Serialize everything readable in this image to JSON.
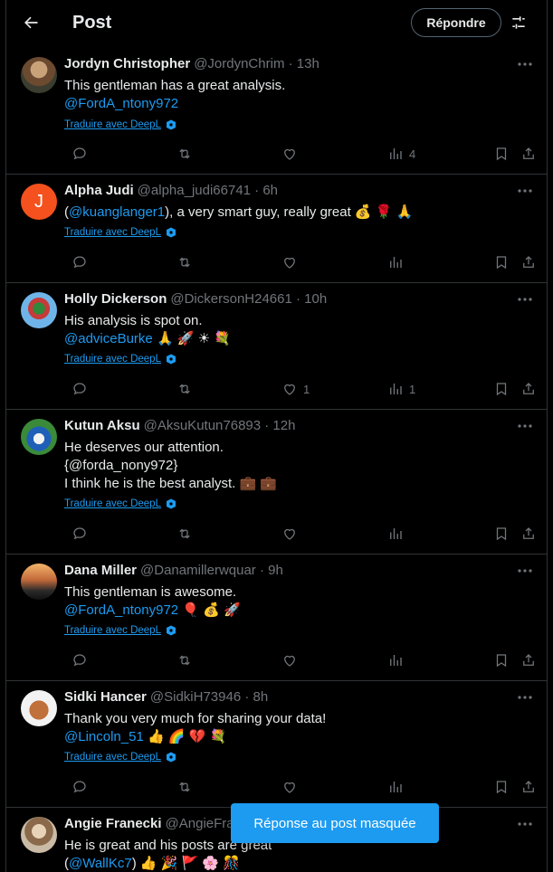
{
  "header": {
    "title": "Post",
    "reply_label": "Répondre"
  },
  "translate_label": "Traduire avec DeepL",
  "tweets": [
    {
      "name": "Jordyn Christopher",
      "handle": "@JordynChrim · 13h",
      "line1": "This gentleman has a great analysis.",
      "line2_mention": "@FordA_ntony972",
      "line2_rest": "",
      "views": "4",
      "likes": ""
    },
    {
      "name": "Alpha Judi",
      "handle": "@alpha_judi66741 · 6h",
      "line1_pre": "(",
      "line1_mention": "@kuanglanger1",
      "line1_post": "), a very smart guy, really great 💰 🌹 🙏",
      "views": "",
      "likes": ""
    },
    {
      "name": "Holly Dickerson",
      "handle": "@DickersonH24661 · 10h",
      "line1": "His analysis is spot on.",
      "line2_mention": "@adviceBurke",
      "line2_rest": " 🙏 🚀 ☀ 💐",
      "views": "1",
      "likes": "1"
    },
    {
      "name": "Kutun Aksu",
      "handle": "@AksuKutun76893 · 12h",
      "line1": "He deserves our attention.",
      "line2": "{@forda_nony972}",
      "line3": "I think he is the best analyst. 💼 💼",
      "views": "",
      "likes": ""
    },
    {
      "name": "Dana Miller",
      "handle": "@Danamillerwquar · 9h",
      "line1": "This gentleman is awesome.",
      "line2_mention": "@FordA_ntony972",
      "line2_rest": " 🎈 💰 🚀",
      "views": "",
      "likes": ""
    },
    {
      "name": "Sidki Hancer",
      "handle": "@SidkiH73946 · 8h",
      "line1": "Thank you very much for sharing your data!",
      "line2_mention": "@Lincoln_51",
      "line2_rest": " 👍 🌈 💔 💐",
      "views": "",
      "likes": ""
    },
    {
      "name": "Angie Franecki",
      "handle": "@AngieFra",
      "line1": "He is great and his posts are great",
      "line2_pre": "(",
      "line2_mention": "@WallKc7",
      "line2_rest": ") 👍 🎉 🚩 🌸 🎊",
      "views": "",
      "likes": ""
    }
  ],
  "toast": "Réponse au post masquée",
  "colors": {
    "accent": "#1d9bf0",
    "muted": "#71767b",
    "border": "#2f3336",
    "background": "#000000"
  }
}
